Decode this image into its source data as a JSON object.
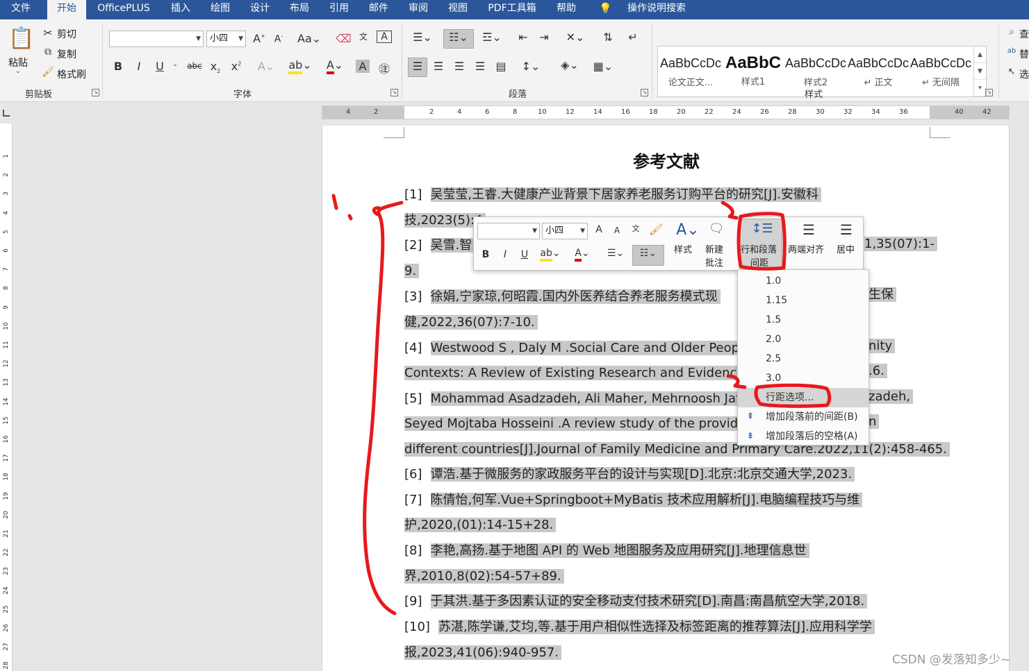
{
  "ribbon_tabs": [
    "文件",
    "开始",
    "OfficePLUS",
    "插入",
    "绘图",
    "设计",
    "布局",
    "引用",
    "邮件",
    "审阅",
    "视图",
    "PDF工具箱",
    "帮助"
  ],
  "tell_me": "操作说明搜索",
  "clipboard": {
    "paste": "粘贴",
    "cut": "剪切",
    "copy": "复制",
    "format_painter": "格式刷",
    "label": "剪贴板"
  },
  "font": {
    "font_name": "",
    "font_size": "小四",
    "label": "字体"
  },
  "paragraph": {
    "label": "段落"
  },
  "styles": {
    "label": "样式",
    "items": [
      {
        "preview": "AaBbCcDc",
        "name": "论文正文..."
      },
      {
        "preview": "AaBbC",
        "name": "样式1"
      },
      {
        "preview": "AaBbCcDc",
        "name": "样式2"
      },
      {
        "preview": "AaBbCcDc",
        "name": "↵ 正文"
      },
      {
        "preview": "AaBbCcDc",
        "name": "↵ 无间隔"
      }
    ]
  },
  "editing": {
    "find": "查",
    "replace": "替",
    "select": "选"
  },
  "ruler": {
    "left": [
      "4",
      "2"
    ],
    "right": [
      "2",
      "4",
      "6",
      "8",
      "10",
      "12",
      "14",
      "16",
      "18",
      "20",
      "22",
      "24",
      "26",
      "28",
      "30",
      "32",
      "34",
      "36",
      "40",
      "42"
    ]
  },
  "vruler": [
    "1",
    "2",
    "3",
    "4",
    "5",
    "6",
    "7",
    "8",
    "9",
    "10",
    "11",
    "12",
    "13",
    "14",
    "15",
    "16",
    "17",
    "18",
    "19",
    "20",
    "21",
    "22",
    "23",
    "24",
    "25",
    "26",
    "27",
    "28"
  ],
  "document": {
    "title": "参考文献",
    "lines": [
      {
        "num": "[1]",
        "text": "吴莹莹,王睿.大健康产业背景下居家养老服务订购平台的研究[J].安徽科"
      },
      {
        "num": "",
        "text": "技,2023(5):4"
      },
      {
        "num": "[2]",
        "text": "吴雪.智"
      },
      {
        "num": "",
        "text": "9."
      },
      {
        "num": "[3]",
        "text": "徐娟,宁家琼,何昭霞.国内外医养结合养老服务模式现"
      },
      {
        "num": "",
        "text": "健,2022,36(07):7-10."
      },
      {
        "num": "[4]",
        "text": "Westwood S , Daly M .Social Care and Older People"
      },
      {
        "num": "",
        "text": "Contexts: A Review of Existing Research and Evidence[J]"
      },
      {
        "num": "[5]",
        "text": "Mohammad Asadzadeh, Ali Maher, Mehrnoosh Jafa"
      },
      {
        "num": "",
        "text": "Seyed Mojtaba Hosseini .A review study of the providing"
      },
      {
        "num": "",
        "text": "different countries[J].Journal of Family Medicine and Primary Care.2022,11(2):458-465."
      },
      {
        "num": "[6]",
        "text": "谭浩.基于微服务的家政服务平台的设计与实现[D].北京:北京交通大学,2023."
      },
      {
        "num": "[7]",
        "text": "陈倩怡,何军.Vue+Springboot+MyBatis 技术应用解析[J].电脑编程技巧与维"
      },
      {
        "num": "",
        "text": "护,2020,(01):14-15+28."
      },
      {
        "num": "[8]",
        "text": "李艳,高扬.基于地图 API 的 Web 地图服务及应用研究[J].地理信息世"
      },
      {
        "num": "",
        "text": "界,2010,8(02):54-57+89."
      },
      {
        "num": "[9]",
        "text": "于其洪.基于多因素认证的安全移动支付技术研究[D].南昌:南昌航空大学,2018."
      },
      {
        "num": "[10]",
        "text": "苏湛,陈学谦,艾均,等.基于用户相似性选择及标签距离的推荐算法[J].应用科学学"
      },
      {
        "num": "",
        "text": "报,2023,41(06):940-957."
      }
    ],
    "right_fragments": {
      "r2": "1,35(07):1-",
      "r3": "生保",
      "r4": "nity",
      "r4b": ".6.",
      "r5": "zadeh,",
      "r5b": "n"
    }
  },
  "mini_toolbar": {
    "font_name": "",
    "font_size": "小四",
    "style": "样式",
    "new_comment_1": "新建",
    "new_comment_2": "批注",
    "line_spacing_1": "行和段落",
    "line_spacing_2": "间距",
    "justify": "两端对齐",
    "center": "居中"
  },
  "spacing_menu": {
    "items": [
      "1.0",
      "1.15",
      "1.5",
      "2.0",
      "2.5",
      "3.0",
      "行距选项...",
      "增加段落前的间距(B)",
      "增加段落后的空格(A)"
    ]
  },
  "annotations": {
    "step1": "1.",
    "step2": "2.",
    "step3": "3."
  },
  "watermark": "CSDN @发落知多少~",
  "colors": {
    "accent": "#2b579a",
    "annotation": "#e8191b",
    "highlight": "#c8c8c8"
  }
}
